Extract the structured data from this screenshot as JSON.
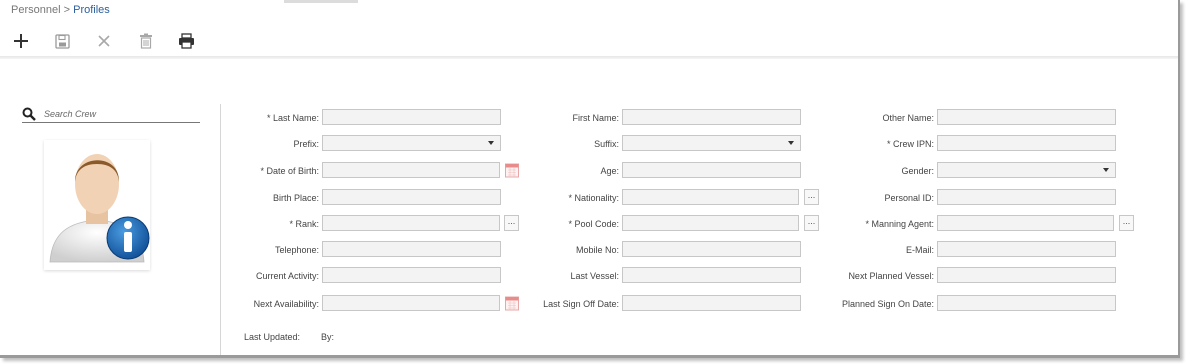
{
  "breadcrumb": {
    "parent": "Personnel",
    "separator": ">",
    "current": "Profiles"
  },
  "toolbar": {
    "buttons": [
      {
        "name": "add",
        "icon": "plus-icon",
        "enabled": true
      },
      {
        "name": "save",
        "icon": "save-icon",
        "enabled": false
      },
      {
        "name": "cancel",
        "icon": "close-icon",
        "enabled": false
      },
      {
        "name": "delete",
        "icon": "trash-icon",
        "enabled": false
      },
      {
        "name": "print",
        "icon": "printer-icon",
        "enabled": true
      }
    ]
  },
  "search": {
    "placeholder": "Search Crew"
  },
  "form": {
    "last_name": {
      "label": "* Last Name:",
      "value": ""
    },
    "first_name": {
      "label": "First Name:",
      "value": ""
    },
    "other_name": {
      "label": "Other Name:",
      "value": ""
    },
    "prefix": {
      "label": "Prefix:",
      "value": ""
    },
    "suffix": {
      "label": "Suffix:",
      "value": ""
    },
    "crew_ipn": {
      "label": "* Crew IPN:",
      "value": ""
    },
    "date_of_birth": {
      "label": "* Date of Birth:",
      "value": ""
    },
    "age": {
      "label": "Age:",
      "value": ""
    },
    "gender": {
      "label": "Gender:",
      "value": ""
    },
    "birth_place": {
      "label": "Birth Place:",
      "value": ""
    },
    "nationality": {
      "label": "* Nationality:",
      "value": ""
    },
    "personal_id": {
      "label": "Personal ID:",
      "value": ""
    },
    "rank": {
      "label": "* Rank:",
      "value": ""
    },
    "pool_code": {
      "label": "* Pool Code:",
      "value": ""
    },
    "manning_agent": {
      "label": "* Manning Agent:",
      "value": ""
    },
    "telephone": {
      "label": "Telephone:",
      "value": ""
    },
    "mobile_no": {
      "label": "Mobile No:",
      "value": ""
    },
    "email": {
      "label": "E-Mail:",
      "value": ""
    },
    "current_activity": {
      "label": "Current Activity:",
      "value": ""
    },
    "last_vessel": {
      "label": "Last Vessel:",
      "value": ""
    },
    "next_planned_vessel": {
      "label": "Next Planned Vessel:",
      "value": ""
    },
    "next_availability": {
      "label": "Next Availability:",
      "value": ""
    },
    "last_sign_off_date": {
      "label": "Last Sign Off Date:",
      "value": ""
    },
    "planned_sign_on_date": {
      "label": "Planned Sign On Date:",
      "value": ""
    }
  },
  "lookup_button_label": "...",
  "footer": {
    "last_updated_label": "Last Updated:",
    "by_label": "By:"
  },
  "colors": {
    "link": "#2c5f9e",
    "input_bg": "#f3f3f3",
    "info_badge": "#1f6fc0"
  }
}
